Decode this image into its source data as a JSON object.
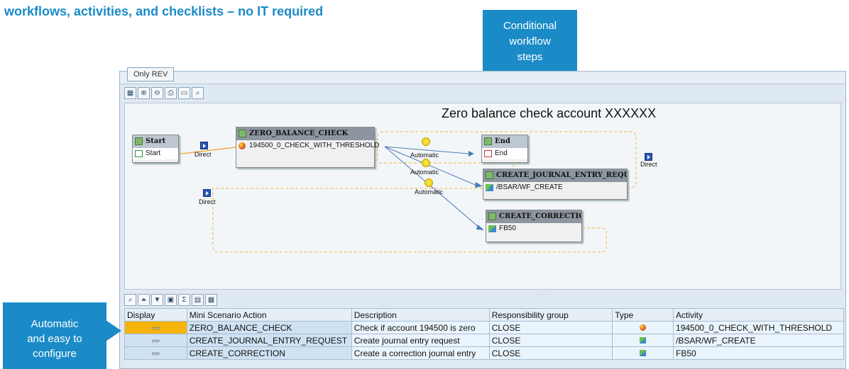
{
  "headline": "workflows, activities, and checklists – no IT required",
  "callout_top": [
    "Conditional",
    "workflow",
    "steps"
  ],
  "callout_left": [
    "Automatic",
    "and easy to",
    "configure"
  ],
  "tab_label": "Only REV",
  "canvas_title": "Zero balance check account XXXXXX",
  "nodes": {
    "start": {
      "title": "Start",
      "body": "Start"
    },
    "zero": {
      "title": "ZERO_BALANCE_CHECK",
      "body": "194500_0_CHECK_WITH_THRESHOLD"
    },
    "end": {
      "title": "End",
      "body": "End"
    },
    "journal": {
      "title": "CREATE_JOURNAL_ENTRY_REQUEST",
      "body": "/BSAR/WF_CREATE"
    },
    "correction": {
      "title": "CREATE_CORRECTION",
      "body": "FB50"
    }
  },
  "edge_labels": {
    "direct": "Direct",
    "automatic": "Automatic"
  },
  "grid": {
    "headers": [
      "Display",
      "Mini Scenario Action",
      "Description",
      "Responsibility group",
      "Type",
      "Activity"
    ],
    "rows": [
      {
        "action": "ZERO_BALANCE_CHECK",
        "description": "Check if account 194500 is zero",
        "group": "CLOSE",
        "type_icon": "status-dot-icon",
        "activity": "194500_0_CHECK_WITH_THRESHOLD"
      },
      {
        "action": "CREATE_JOURNAL_ENTRY_REQUEST",
        "description": "Create journal entry request",
        "group": "CLOSE",
        "type_icon": "transaction-icon",
        "activity": "/BSAR/WF_CREATE"
      },
      {
        "action": "CREATE_CORRECTION",
        "description": "Create a correction journal entry",
        "group": "CLOSE",
        "type_icon": "transaction-icon",
        "activity": "FB50"
      }
    ]
  },
  "colors": {
    "accent": "#1a8bc7",
    "selected_row": "#f6b40a",
    "workflow_edge": "#4a7ab8",
    "dashed_edge": "#e8b840"
  }
}
